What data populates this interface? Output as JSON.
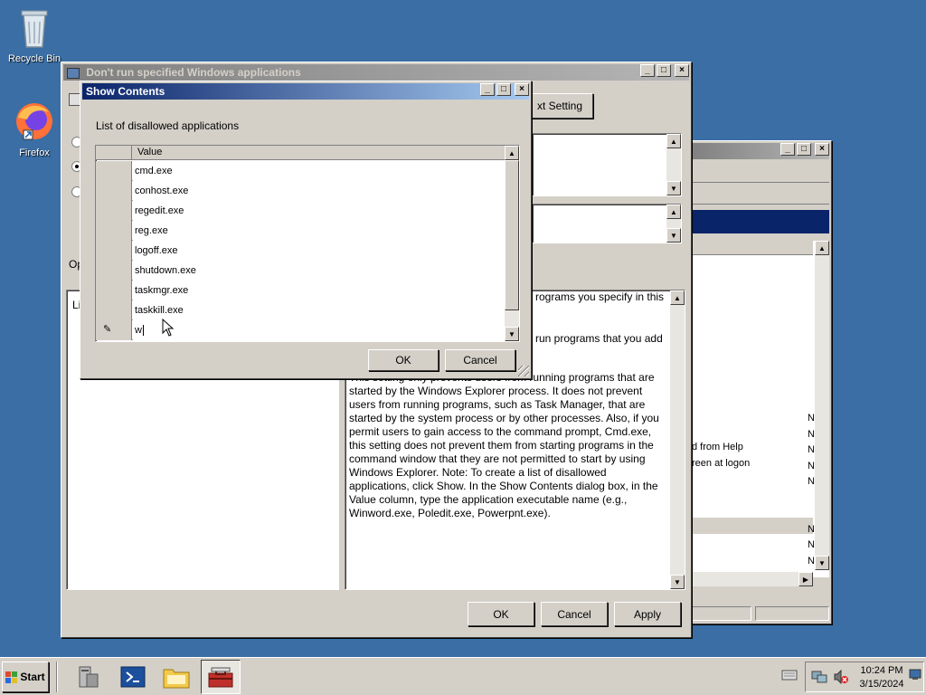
{
  "desktop": {
    "icons": [
      {
        "label": "Recycle Bin"
      },
      {
        "label": "Firefox"
      }
    ]
  },
  "policy_window": {
    "title": "Don't run specified Windows applications",
    "next_setting_label": "xt Setting",
    "options_partial": "Op",
    "left_panel_partial": "Li",
    "help_lines": [
      "rograms you specify in this",
      "run programs that you add"
    ],
    "help_text": "This setting only prevents users from running programs that are started by the Windows Explorer process. It does not prevent users from running programs, such as Task Manager, that are started by the system process or by other processes. Also, if you permit users to gain access to the command prompt, Cmd.exe, this setting does not prevent them from starting programs in the command window that they are not permitted to start by using Windows Explorer. Note: To create a list of disallowed applications, click Show. In the Show Contents dialog box, in the Value column, type the application executable name (e.g., Winword.exe, Poledit.exe, Powerpnt.exe).",
    "ok_label": "OK",
    "cancel_label": "Cancel",
    "apply_label": "Apply"
  },
  "background_window": {
    "rows": [
      {
        "label": "d from Help",
        "state": "N"
      },
      {
        "label": "reen at logon",
        "state": "N"
      }
    ],
    "state_column": [
      "N",
      "N",
      "N",
      "N",
      "N",
      "N",
      "N",
      "N"
    ]
  },
  "show_contents": {
    "title": "Show Contents",
    "list_label": "List of disallowed applications",
    "column_header": "Value",
    "values": [
      "cmd.exe",
      "conhost.exe",
      "regedit.exe",
      "reg.exe",
      "logoff.exe",
      "shutdown.exe",
      "taskmgr.exe",
      "taskkill.exe"
    ],
    "editing_value": "w",
    "ok_label": "OK",
    "cancel_label": "Cancel"
  },
  "taskbar": {
    "start_label": "Start",
    "time": "10:24 PM",
    "date": "3/15/2024"
  }
}
